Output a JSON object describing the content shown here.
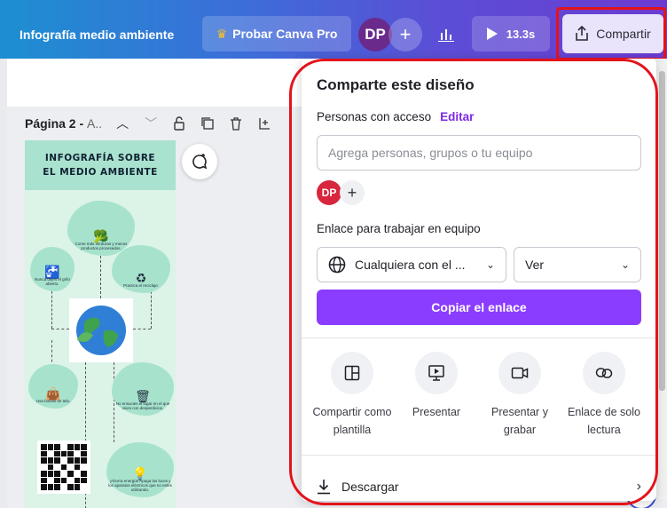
{
  "topbar": {
    "doc_title": "Infografía medio ambiente",
    "pro_label": "Probar Canva Pro",
    "avatar_initials": "DP",
    "plus": "+",
    "timer": "13.3s",
    "share_label": "Compartir"
  },
  "editor": {
    "page_label": "Página 2 - ",
    "page_suffix": "A.."
  },
  "infographic": {
    "title_line1": "INFOGRAFÍA SOBRE",
    "title_line2": "EL MEDIO AMBIENTE",
    "tip_cars": "Come más verduras y menos productos procesados.",
    "tip_tap": "Nunca dejes el grifo abierto.",
    "tip_recycle": "Practica el reciclaje.",
    "tip_bags": "Usa bolsas de tela.",
    "tip_trash": "No ensucies el lugar en el que vives con desperdicios.",
    "tip_energy": "¡Ahorra energía! Apaga las luces y los aparatos eléctricos que no estés utilizando."
  },
  "share_panel": {
    "title": "Comparte este diseño",
    "access_label": "Personas con acceso",
    "edit_link": "Editar",
    "people_placeholder": "Agrega personas, grupos o tu equipo",
    "avatar_initials": "DP",
    "plus": "+",
    "team_link_label": "Enlace para trabajar en equipo",
    "scope_value": "Cualquiera con el ...",
    "permission_value": "Ver",
    "copy_button": "Copiar el enlace",
    "actions": [
      {
        "label": "Compartir como plantilla",
        "icon": "template-icon"
      },
      {
        "label": "Presentar",
        "icon": "present-icon"
      },
      {
        "label": "Presentar y grabar",
        "icon": "record-icon"
      },
      {
        "label": "Enlace de solo lectura",
        "icon": "link-icon"
      }
    ],
    "download_label": "Descargar"
  },
  "colors": {
    "accent": "#8b3dff",
    "highlight": "#e3131c",
    "edit_link": "#7d2ae8"
  }
}
